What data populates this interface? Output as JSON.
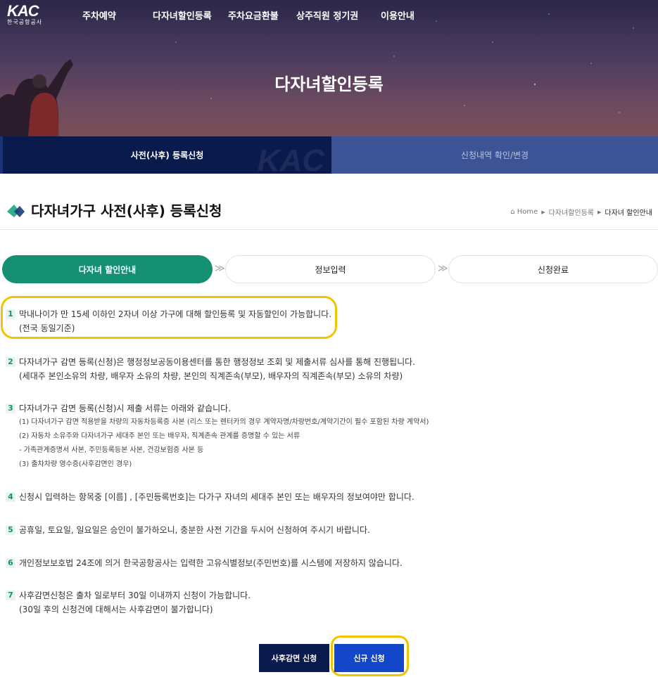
{
  "logo": {
    "mark": "KAC",
    "sub": "한국공항공사"
  },
  "gnb": [
    "주차예약",
    "다자녀할인등록",
    "주차요금환불",
    "상주직원 정기권",
    "이용안내"
  ],
  "hero": {
    "title": "다자녀할인등록"
  },
  "subtabs": {
    "active": "사전(사후) 등록신청",
    "inactive": "신청내역 확인/변경",
    "watermark": "KAC"
  },
  "page": {
    "title": "다자녀가구 사전(사후) 등록신청"
  },
  "breadcrumb": {
    "home": "Home",
    "level1": "다자녀할인등록",
    "current": "다자녀 할인안내"
  },
  "steps": [
    "다자녀 할인안내",
    "정보입력",
    "신청완료"
  ],
  "notices": [
    {
      "num": "1",
      "text": "막내나이가 만 15세 이하인 2자녀 이상 가구에 대해 할인등록 및 자동할인이 가능합니다.",
      "sub": "(전국 동일기준)"
    },
    {
      "num": "2",
      "text": "다자녀가구 감면 등록(신청)은 행정정보공동이용센터를 통한 행정정보 조회 및 제출서류 심사를 통해 진행됩니다.",
      "sub": "(세대주 본인소유의 차량, 배우자 소유의 차량, 본인의 직계존속(부모), 배우자의 직계존속(부모) 소유의 차량)"
    },
    {
      "num": "3",
      "text": "다자녀가구 감면 등록(신청)시 제출 서류는 아래와 같습니다.",
      "items": [
        "(1) 다자녀가구 감면 적용받을 차량의 자동차등록증 사본 (리스 또는 렌터카의 경우 계약자명/차량번호/계약기간이 필수 포함된 차량 계약서)",
        "(2) 자동차 소유주와 다자녀가구 세대주 본인 또는 배우자, 직계존속 관계를 증명할 수 있는 서류",
        "- 가족관계증명서 사본, 주민등록등본 사본, 건강보험증 사본 등",
        "(3) 출차차량 영수증(사후감면인 경우)"
      ]
    },
    {
      "num": "4",
      "text": "신청시 입력하는 항목중 [이름] , [주민등록번호]는 다가구 자녀의 세대주 본인 또는 배우자의 정보여야만 합니다."
    },
    {
      "num": "5",
      "text": "공휴일, 토요일, 일요일은 승인이 불가하오니, 충분한 사전 기간을 두시어 신청하여 주시기 바랍니다."
    },
    {
      "num": "6",
      "text": "개인정보보호법 24조에 의거 한국공항공사는 입력한 고유식별정보(주민번호)를 시스템에 저장하지 않습니다."
    },
    {
      "num": "7",
      "text": "사후감면신청은 출차 일로부터 30일 이내까지 신청이 가능합니다.",
      "sub": "(30일 후의 신청건에 대해서는 사후감면이 불가합니다)"
    }
  ],
  "buttons": {
    "post": "사후감면 신청",
    "new": "신규 신청"
  },
  "colors": {
    "primary": "#159073",
    "navy": "#0b1a4d",
    "blue": "#1346c9",
    "highlight": "#f2c300"
  }
}
